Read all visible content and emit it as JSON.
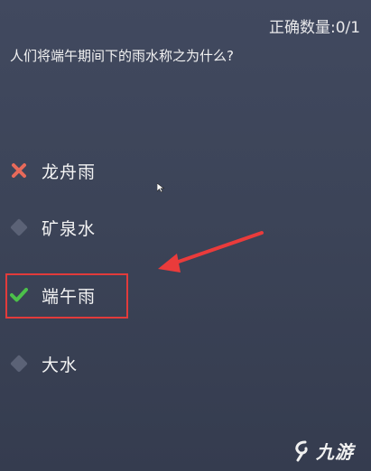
{
  "score": {
    "label": "正确数量:0/1"
  },
  "question": {
    "text": "人们将端午期间下的雨水称之为什么?"
  },
  "options": [
    {
      "label": "龙舟雨",
      "state": "wrong"
    },
    {
      "label": "矿泉水",
      "state": "neutral"
    },
    {
      "label": "端午雨",
      "state": "correct"
    },
    {
      "label": "大水",
      "state": "neutral"
    }
  ],
  "watermark": {
    "text": "九游"
  },
  "colors": {
    "wrong": "#e86a5a",
    "correct": "#4cc04a",
    "highlight": "#e23b3b",
    "neutral": "#5b6276"
  }
}
